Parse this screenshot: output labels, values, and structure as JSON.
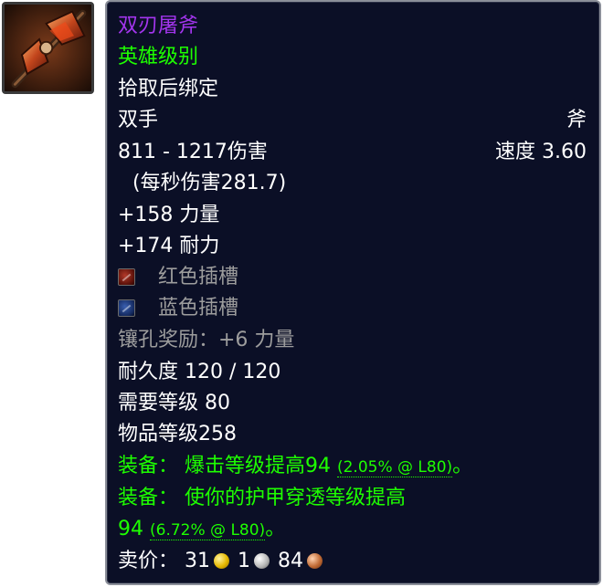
{
  "item": {
    "name": "双刃屠斧",
    "quality": "英雄级别",
    "binding": "拾取后绑定",
    "hands": "双手",
    "weapon_type": "斧",
    "damage": "811 - 1217伤害",
    "speed": "速度 3.60",
    "dps": "(每秒伤害281.7)",
    "stat_strength": "+158 力量",
    "stat_stamina": "+174 耐力",
    "socket_red": "红色插槽",
    "socket_blue": "蓝色插槽",
    "socket_bonus": "镶孔奖励：+6 力量",
    "durability": "耐久度 120 / 120",
    "required_level": "需要等级 80",
    "item_level": "物品等级258",
    "equip1_prefix": "装备：  爆击等级提高94 ",
    "equip1_detail": "(2.05% @ L80)",
    "equip1_suffix": "。",
    "equip2_line1": "装备：  使你的护甲穿透等级提高",
    "equip2_prefix": "94 ",
    "equip2_detail": "(6.72% @ L80)",
    "equip2_suffix": "。",
    "sell_label": "卖价：",
    "sell_gold": "31",
    "sell_silver": "1",
    "sell_copper": "84"
  },
  "colors": {
    "epic": "#a335ee",
    "uncommon": "#1eff00",
    "disabled": "#9d9d9d",
    "background": "#0b0f26"
  },
  "icons": {
    "item_icon": "double-bladed-axe-icon",
    "red_socket": "red-socket-icon",
    "blue_socket": "blue-socket-icon",
    "gold": "gold-coin-icon",
    "silver": "silver-coin-icon",
    "copper": "copper-coin-icon"
  }
}
